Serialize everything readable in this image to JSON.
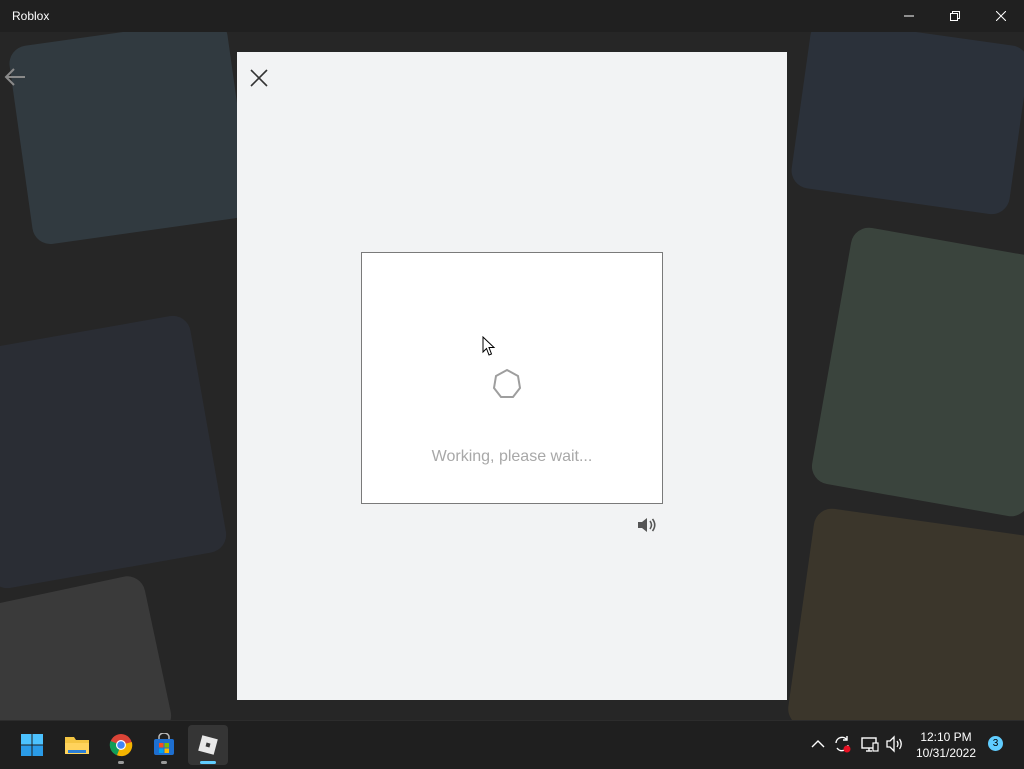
{
  "window": {
    "title": "Roblox",
    "controls": {
      "minimize": "minimize-icon",
      "restore": "restore-icon",
      "close": "close-icon"
    }
  },
  "modal": {
    "close_icon": "close-icon",
    "status_text": "Working, please wait...",
    "spinner_icon": "hexagon-spinner-icon",
    "audio_icon": "speaker-icon"
  },
  "taskbar": {
    "pinned": [
      {
        "name": "start",
        "icon": "windows-start-icon"
      },
      {
        "name": "file-explorer",
        "icon": "folder-icon"
      },
      {
        "name": "chrome",
        "icon": "chrome-icon"
      },
      {
        "name": "microsoft-store",
        "icon": "store-icon"
      },
      {
        "name": "roblox",
        "icon": "roblox-icon",
        "active": true
      }
    ],
    "tray": {
      "time": "12:10 PM",
      "date": "10/31/2022",
      "notification_count": "3"
    }
  },
  "colors": {
    "accent": "#60cdff",
    "modal_bg": "#f2f3f4",
    "titlebar_bg": "#202020",
    "taskbar_bg": "#1f1f1f"
  }
}
